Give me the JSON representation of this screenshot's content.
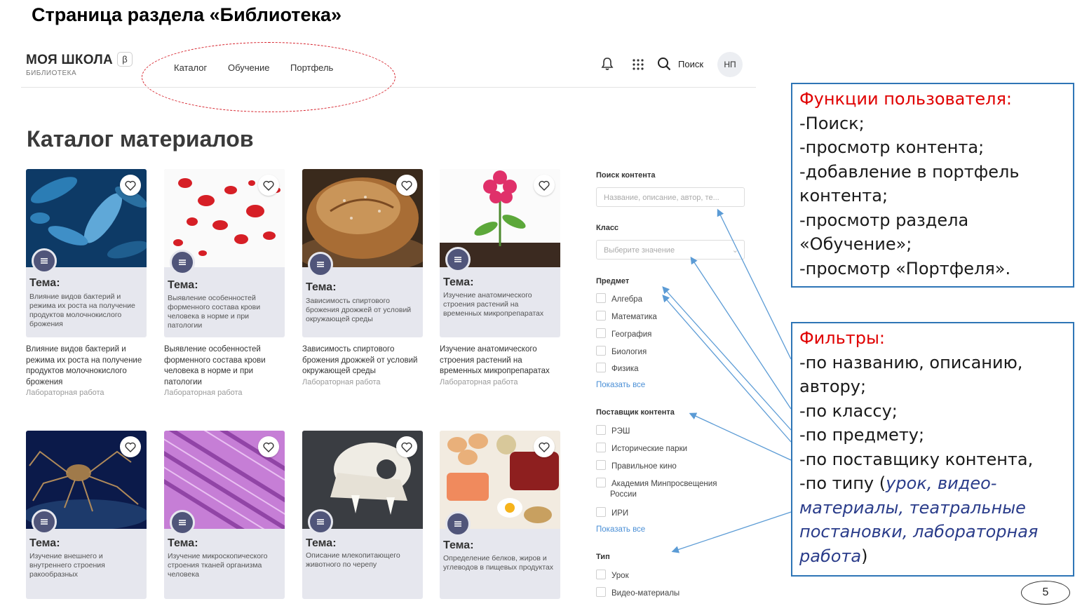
{
  "slide": {
    "title": "Страница раздела «Библиотека»",
    "page_number": "5"
  },
  "header": {
    "logo_name": "МОЯ ШКОЛА",
    "logo_beta": "β",
    "logo_sub": "БИБЛИОТЕКА",
    "nav": [
      "Каталог",
      "Обучение",
      "Портфель"
    ],
    "search_label": "Поиск",
    "avatar": "НП",
    "icons": [
      "bell-icon",
      "apps-grid-icon",
      "search-icon"
    ]
  },
  "page_title": "Каталог материалов",
  "cards": [
    {
      "tema": "Тема:",
      "desc": "Влияние видов бактерий и режима их роста на получение продуктов молочнокислого брожения",
      "title": "Влияние видов бактерий и режима их роста на получение продуктов молочнокислого брожения",
      "type": "Лабораторная работа",
      "image": "bacteria"
    },
    {
      "tema": "Тема:",
      "desc": "Выявление особенностей форменного состава крови человека в норме и при патологии",
      "title": "Выявление особенностей форменного состава крови человека в норме и при патологии",
      "type": "Лабораторная работа",
      "image": "blood-cells"
    },
    {
      "tema": "Тема:",
      "desc": "Зависимость спиртового брожения дрожжей от условий окружающей среды",
      "title": "Зависимость спиртового брожения дрожжей от условий окружающей среды",
      "type": "Лабораторная работа",
      "image": "bread"
    },
    {
      "tema": "Тема:",
      "desc": "Изучение анатомического строения растений на временных микропрепаратах",
      "title": "Изучение анатомического строения растений на временных микропрепаратах",
      "type": "Лабораторная работа",
      "image": "flower"
    },
    {
      "tema": "Тема:",
      "desc": "Изучение внешнего и внутреннего строения ракообразных",
      "image": "crab"
    },
    {
      "tema": "Тема:",
      "desc": "Изучение микроскопического строения тканей организма человека",
      "image": "muscle-tissue"
    },
    {
      "tema": "Тема:",
      "desc": "Описание млекопитающего животного по черепу",
      "image": "skull"
    },
    {
      "tema": "Тема:",
      "desc": "Определение белков, жиров и углеводов в пищевых продуктах",
      "image": "food"
    }
  ],
  "filters": {
    "search_heading": "Поиск контента",
    "search_placeholder": "Название, описание, автор, те...",
    "class_heading": "Класс",
    "class_placeholder": "Выберите значение",
    "subject_heading": "Предмет",
    "subjects": [
      "Алгебра",
      "Математика",
      "География",
      "Биология",
      "Физика"
    ],
    "show_all": "Показать все",
    "provider_heading": "Поставщик контента",
    "providers": [
      "РЭШ",
      "Исторические парки",
      "Правильное кино",
      "Академия Минпросвещения",
      "ИРИ"
    ],
    "provider_wrap": "России",
    "type_heading": "Тип",
    "types": [
      "Урок",
      "Видео-материалы"
    ]
  },
  "annotations": {
    "functions_title": "Функции пользователя:",
    "functions": [
      "-Поиск;",
      "-просмотр контента;",
      "-добавление в портфель",
      "контента;",
      "-просмотр раздела",
      "«Обучение»;",
      "-просмотр «Портфеля»."
    ],
    "filters_title": "Фильтры:",
    "filters_lines": [
      "-по названию, описанию,",
      "автору;",
      "-по классу;",
      "-по предмету;",
      "-по поставщику контента,"
    ],
    "type_prefix": "-по типу (",
    "type_italic_1": "урок, видео-",
    "type_italic_2": "материалы, театральные",
    "type_italic_3": "постановки,  лабораторная",
    "type_italic_4": "работа",
    "type_suffix": ")"
  },
  "colors": {
    "accent_red": "#e00000",
    "link_blue": "#4a8fd6",
    "box_border": "#2e75b6",
    "badge": "#50557a"
  }
}
